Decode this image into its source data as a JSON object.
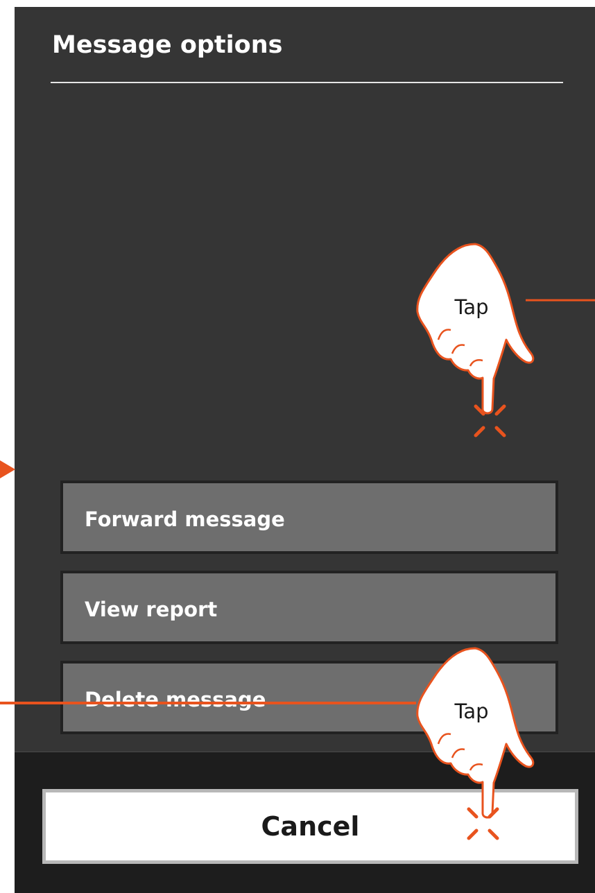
{
  "dialog": {
    "title": "Message options"
  },
  "options": [
    {
      "label": "Forward message"
    },
    {
      "label": "View report"
    },
    {
      "label": "Delete message"
    }
  ],
  "footer": {
    "cancel_label": "Cancel"
  },
  "annotations": {
    "tap_top_label": "Tap",
    "tap_bottom_label": "Tap",
    "accent_color": "#e8531e",
    "gesture_icon": "tap-finger-icon"
  }
}
